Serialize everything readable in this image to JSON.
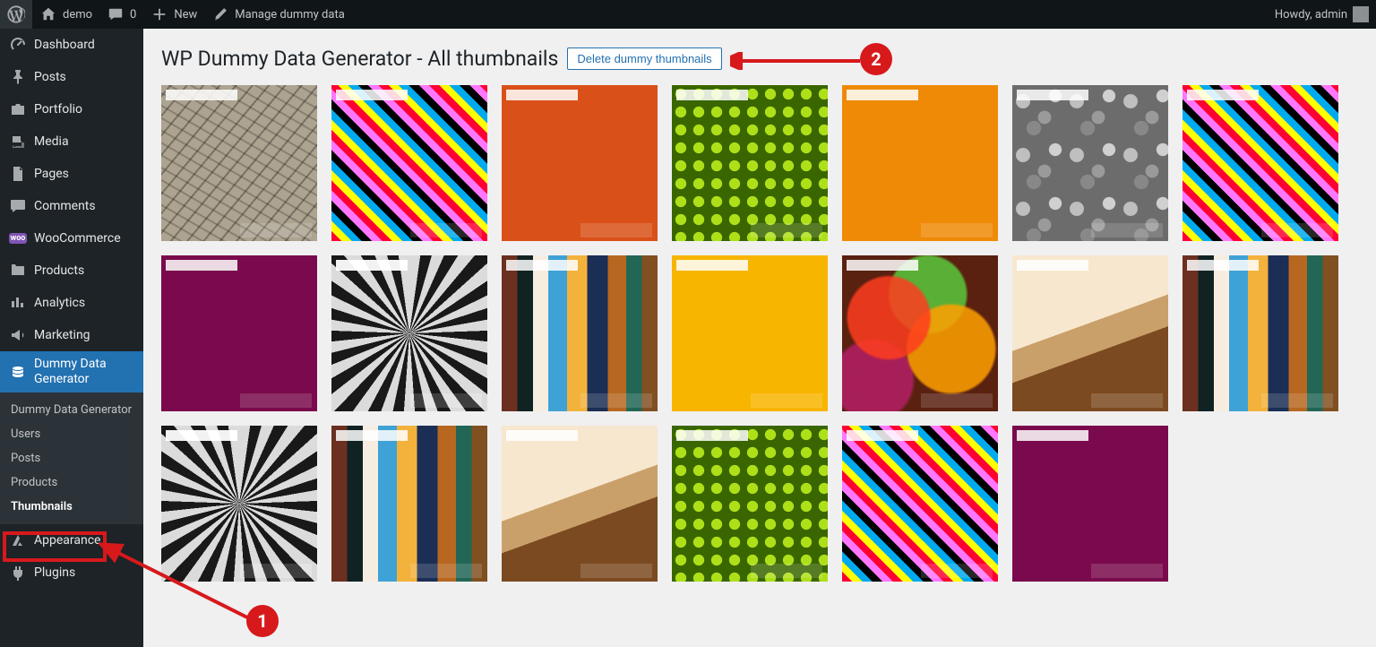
{
  "adminbar": {
    "site_name": "demo",
    "comments_count": "0",
    "new_label": "New",
    "manage_label": "Manage dummy data",
    "howdy": "Howdy, admin"
  },
  "sidebar": {
    "items": [
      {
        "icon": "dashboard",
        "label": "Dashboard"
      },
      {
        "icon": "pin",
        "label": "Posts"
      },
      {
        "icon": "portfolio",
        "label": "Portfolio"
      },
      {
        "icon": "media",
        "label": "Media"
      },
      {
        "icon": "page",
        "label": "Pages"
      },
      {
        "icon": "comments",
        "label": "Comments"
      },
      {
        "icon": "woo",
        "label": "WooCommerce"
      },
      {
        "icon": "products",
        "label": "Products"
      },
      {
        "icon": "analytics",
        "label": "Analytics"
      },
      {
        "icon": "marketing",
        "label": "Marketing"
      },
      {
        "icon": "dummy",
        "label": "Dummy Data Generator",
        "active": true
      },
      {
        "icon": "appearance",
        "label": "Appearance"
      },
      {
        "icon": "plugins",
        "label": "Plugins"
      }
    ],
    "submenu": [
      {
        "label": "Dummy Data Generator"
      },
      {
        "label": "Users"
      },
      {
        "label": "Posts"
      },
      {
        "label": "Products"
      },
      {
        "label": "Thumbnails",
        "current": true
      }
    ]
  },
  "page": {
    "title": "WP Dummy Data Generator - All thumbnails",
    "delete_btn": "Delete dummy thumbnails"
  },
  "annotations": {
    "badge1": "1",
    "badge2": "2"
  },
  "thumbs": [
    [
      "cracked",
      "stripes",
      "orange",
      "hex",
      "amber",
      "pebbles",
      "stripes"
    ],
    [
      "maroon",
      "spiral",
      "blur",
      "yellow",
      "bokeh",
      "curve",
      "blur"
    ],
    [
      "spiral",
      "blur",
      "curve",
      "hex",
      "stripes",
      "maroon"
    ]
  ]
}
